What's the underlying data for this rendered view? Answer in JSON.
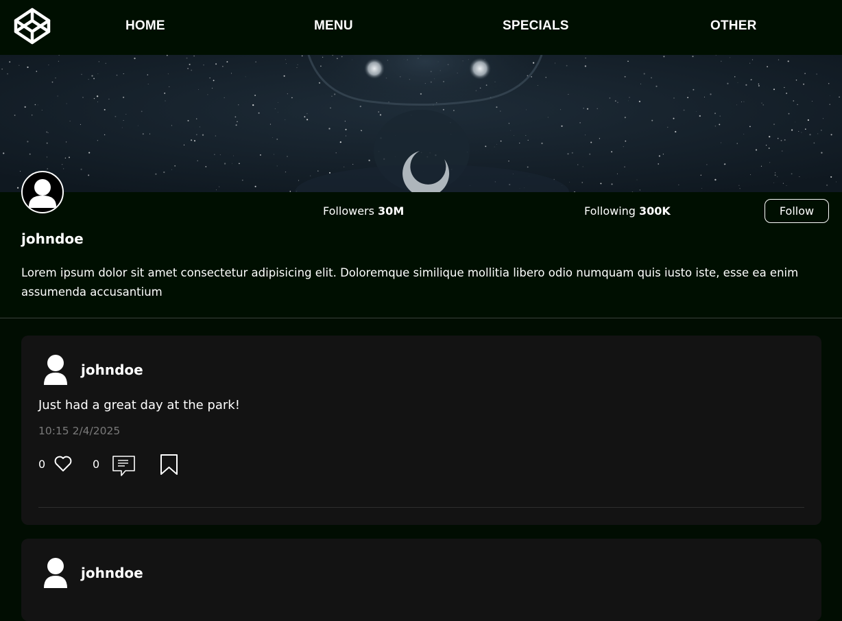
{
  "nav": {
    "logo_icon": "codepen-logo-icon",
    "items": [
      {
        "label": "HOME"
      },
      {
        "label": "MENU"
      },
      {
        "label": "SPECIALS"
      },
      {
        "label": "OTHER"
      }
    ]
  },
  "profile": {
    "followers_label": "Followers",
    "followers_count": "30M",
    "following_label": "Following",
    "following_count": "300K",
    "follow_button": "Follow",
    "username": "johndoe",
    "bio": "Lorem ipsum dolor sit amet consectetur adipisicing elit. Doloremque similique mollitia libero odio numquam quis iusto iste, esse ea enim assumenda accusantium"
  },
  "posts": [
    {
      "username": "johndoe",
      "text": "Just had a great day at the park!",
      "time": "10:15 2/4/2025",
      "likes": "0",
      "comments": "0"
    },
    {
      "username": "johndoe"
    }
  ],
  "colors": {
    "background": "#010d02",
    "header": "#000f01",
    "card": "#131313",
    "muted_text": "#7a7a7a"
  }
}
